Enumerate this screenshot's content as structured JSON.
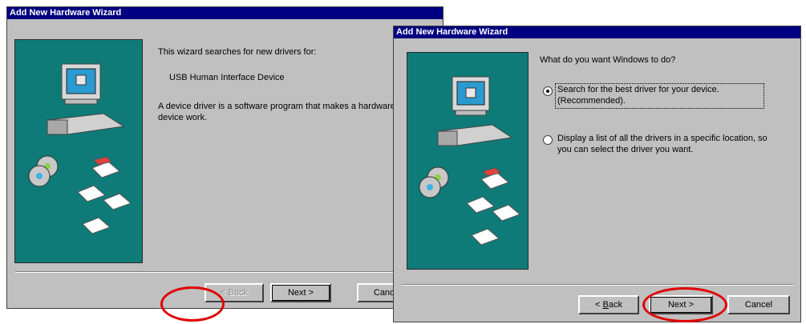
{
  "window1": {
    "title": "Add New Hardware Wizard",
    "intro": "This wizard searches for new drivers for:",
    "device": "USB Human Interface Device",
    "description": "A device driver is a software program that makes a hardware device work.",
    "back_label": "< Back",
    "next_label": "Next >",
    "cancel_label": "Cancel"
  },
  "window2": {
    "title": "Add New Hardware Wizard",
    "question": "What do you want Windows to do?",
    "option1": "Search for the best driver for your device. (Recommended).",
    "option2": "Display a list of all the drivers in a specific location, so you can select the driver you want.",
    "back_label_pre": "< ",
    "back_label_accel": "B",
    "back_label_post": "ack",
    "next_label": "Next >",
    "cancel_label": "Cancel"
  },
  "colors": {
    "title_bar": "#000080",
    "dialog_bg": "#c0c0c0",
    "art_panel": "#0f7b78",
    "highlight_circle": "#e00000"
  }
}
